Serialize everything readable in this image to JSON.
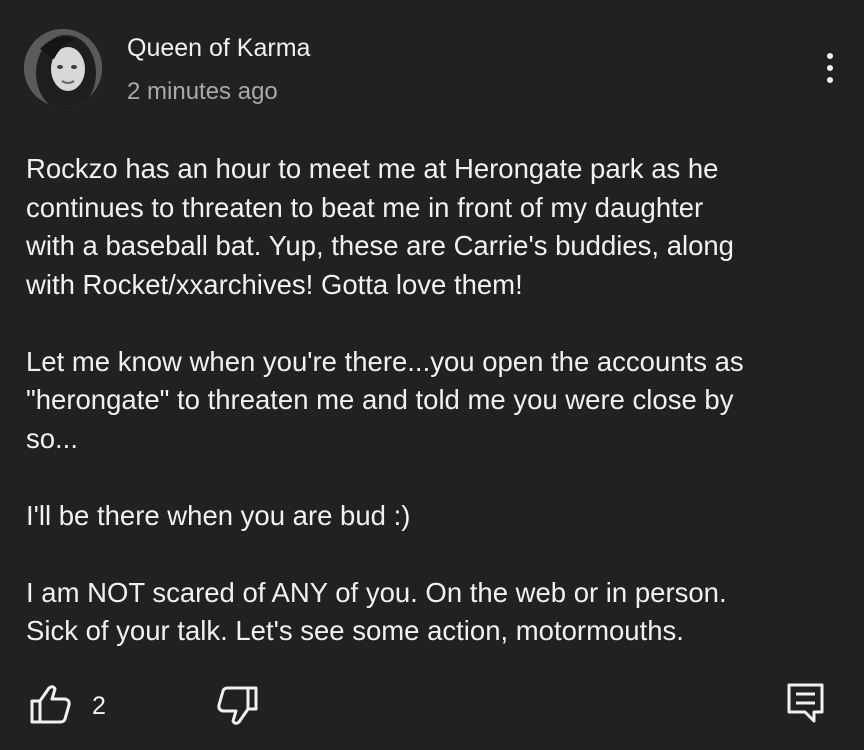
{
  "comment": {
    "author": "Queen of Karma",
    "timestamp": "2 minutes ago",
    "paragraphs": [
      "Rockzo has an hour to meet me at Herongate park as he\ncontinues to threaten to beat me in front of my daughter\nwith a baseball bat. Yup, these are Carrie's buddies, along\nwith Rocket/xxarchives! Gotta love them!",
      "Let me know when you're there...you open the accounts as\n\"herongate\" to threaten me and told me you were close by\nso...",
      "I'll be there when you are bud :)",
      "I am NOT scared of ANY of you. On the web or in person.\nSick of your talk. Let's see some action, motormouths."
    ],
    "like_count": "2"
  },
  "icons": {
    "avatar": "profile-avatar",
    "more": "more-vertical-icon",
    "like": "thumbs-up-icon",
    "dislike": "thumbs-down-icon",
    "reply": "reply-comment-icon"
  },
  "colors": {
    "background": "#212121",
    "text": "#f1f1f1",
    "secondary_text": "#aaaaaa"
  }
}
